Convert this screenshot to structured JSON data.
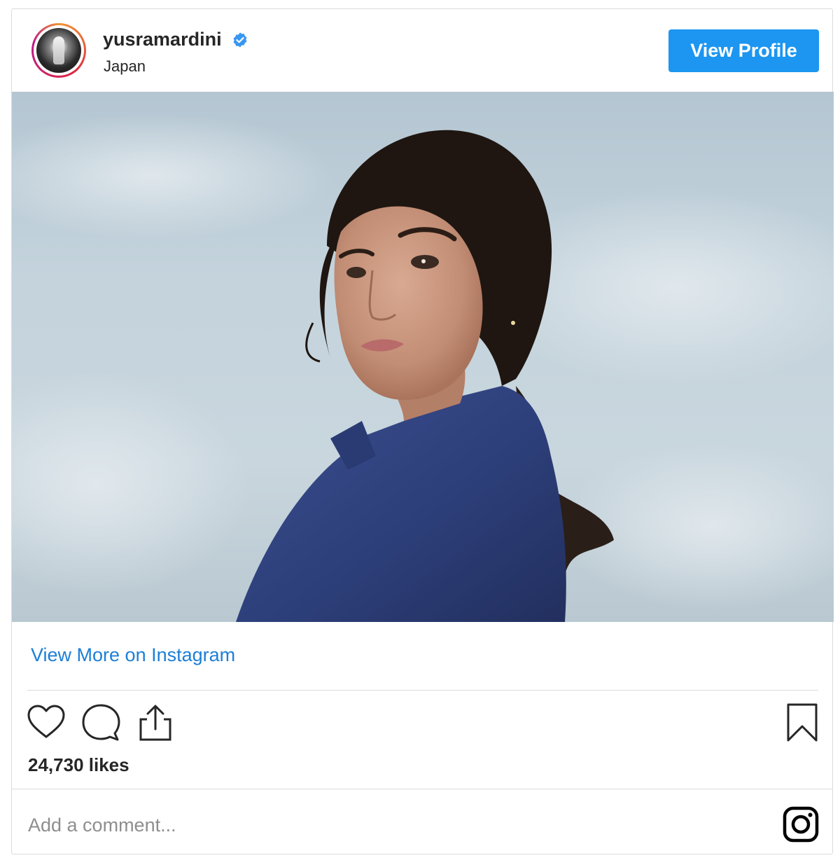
{
  "post": {
    "username": "yusramardini",
    "location": "Japan",
    "view_profile_label": "View Profile",
    "view_more_label": "View More on Instagram",
    "likes_text": "24,730 likes",
    "comment_placeholder": "Add a comment..."
  },
  "colors": {
    "accent_blue": "#1c96f0",
    "link_blue": "#1c7fd6",
    "verified_blue": "#3897f0",
    "text": "#262626",
    "muted": "#8e8e8e",
    "border": "#dbdbdb"
  },
  "icons": [
    "verified-badge-icon",
    "heart-icon",
    "comment-icon",
    "share-icon",
    "bookmark-icon",
    "instagram-icon"
  ]
}
